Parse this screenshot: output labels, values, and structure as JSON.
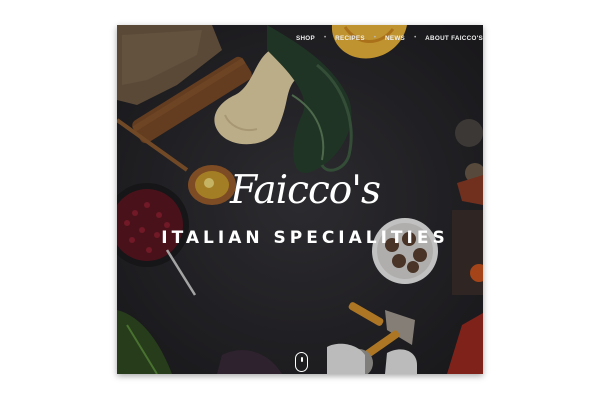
{
  "nav": {
    "items": [
      "SHOP",
      "RECIPES",
      "NEWS",
      "ABOUT FAICCO'S"
    ],
    "separator": "•"
  },
  "hero": {
    "title": "Faicco's",
    "subtitle": "ITALIAN SPECIALITIES",
    "scroll_icon": "mouse-scroll-icon"
  },
  "colors": {
    "background": "#2a2a2c",
    "text": "#ffffff"
  }
}
